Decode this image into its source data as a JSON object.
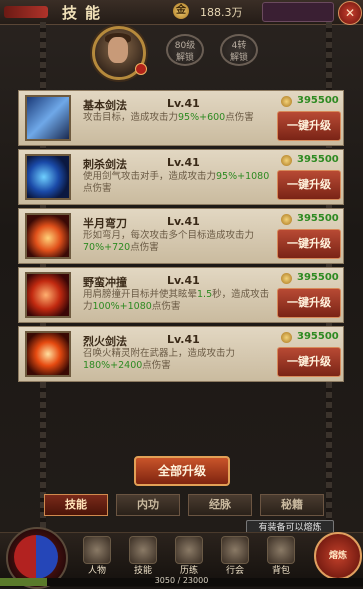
{
  "header": {
    "title": "技能",
    "gold_amount": "188.3万",
    "notice_text": "有装备可以熔炼"
  },
  "profile": {
    "tier_level": "80级\n解锁",
    "tier_level_line1": "80级",
    "tier_level_line2": "解锁",
    "tier_rebirth_line1": "4转",
    "tier_rebirth_line2": "解锁"
  },
  "skills": [
    {
      "name": "基本剑法",
      "level": "Lv.41",
      "desc_pre": "攻击目标，造成攻击力",
      "desc_hl": "95%+600",
      "desc_post": "点伤害",
      "cost": "395500",
      "upgrade_label": "一键升级",
      "icon": "sword-slash-icon"
    },
    {
      "name": "刺杀剑法",
      "level": "Lv.41",
      "desc_pre": "使用剑气攻击对手，造成攻击力",
      "desc_hl": "95%+1080",
      "desc_post": "点伤害",
      "cost": "395500",
      "upgrade_label": "一键升级",
      "icon": "crescent-slash-icon"
    },
    {
      "name": "半月弯刀",
      "level": "Lv.41",
      "desc_pre": "形如弯月，每次攻击多个目标造成攻击力",
      "desc_hl": "70%+720",
      "desc_post": "点伤害",
      "cost": "395500",
      "upgrade_label": "一键升级",
      "icon": "half-moon-blade-icon"
    },
    {
      "name": "野蛮冲撞",
      "level": "Lv.41",
      "desc_pre": "用肩膀撞开目标并使其眩晕",
      "desc_hl": "1.5",
      "desc_mid": "秒，造成攻击力",
      "desc_hl2": "100%+1080",
      "desc_post": "点伤害",
      "cost": "395500",
      "upgrade_label": "一键升级",
      "icon": "charging-man-icon"
    },
    {
      "name": "烈火剑法",
      "level": "Lv.41",
      "desc_pre": "召唤火精灵附在武器上，造成攻击力",
      "desc_hl": "180%+2400",
      "desc_post": "点伤害",
      "cost": "395500",
      "upgrade_label": "一键升级",
      "icon": "flame-sword-icon"
    }
  ],
  "all_upgrade_label": "全部升级",
  "tabs": [
    {
      "label": "技能",
      "active": true
    },
    {
      "label": "内功",
      "active": false
    },
    {
      "label": "经脉",
      "active": false
    },
    {
      "label": "秘籍",
      "active": false
    }
  ],
  "forge_tip": "有装备可以熔炼",
  "bottom_nav": [
    {
      "label": "人物",
      "icon": "helmet-icon"
    },
    {
      "label": "技能",
      "icon": "skill-book-icon"
    },
    {
      "label": "历练",
      "icon": "training-icon"
    },
    {
      "label": "行会",
      "icon": "guild-icon"
    },
    {
      "label": "背包",
      "icon": "backpack-icon"
    }
  ],
  "forge_button_label": "熔炼",
  "exp_text": "3050 / 23000",
  "exp_fraction": 0.13
}
